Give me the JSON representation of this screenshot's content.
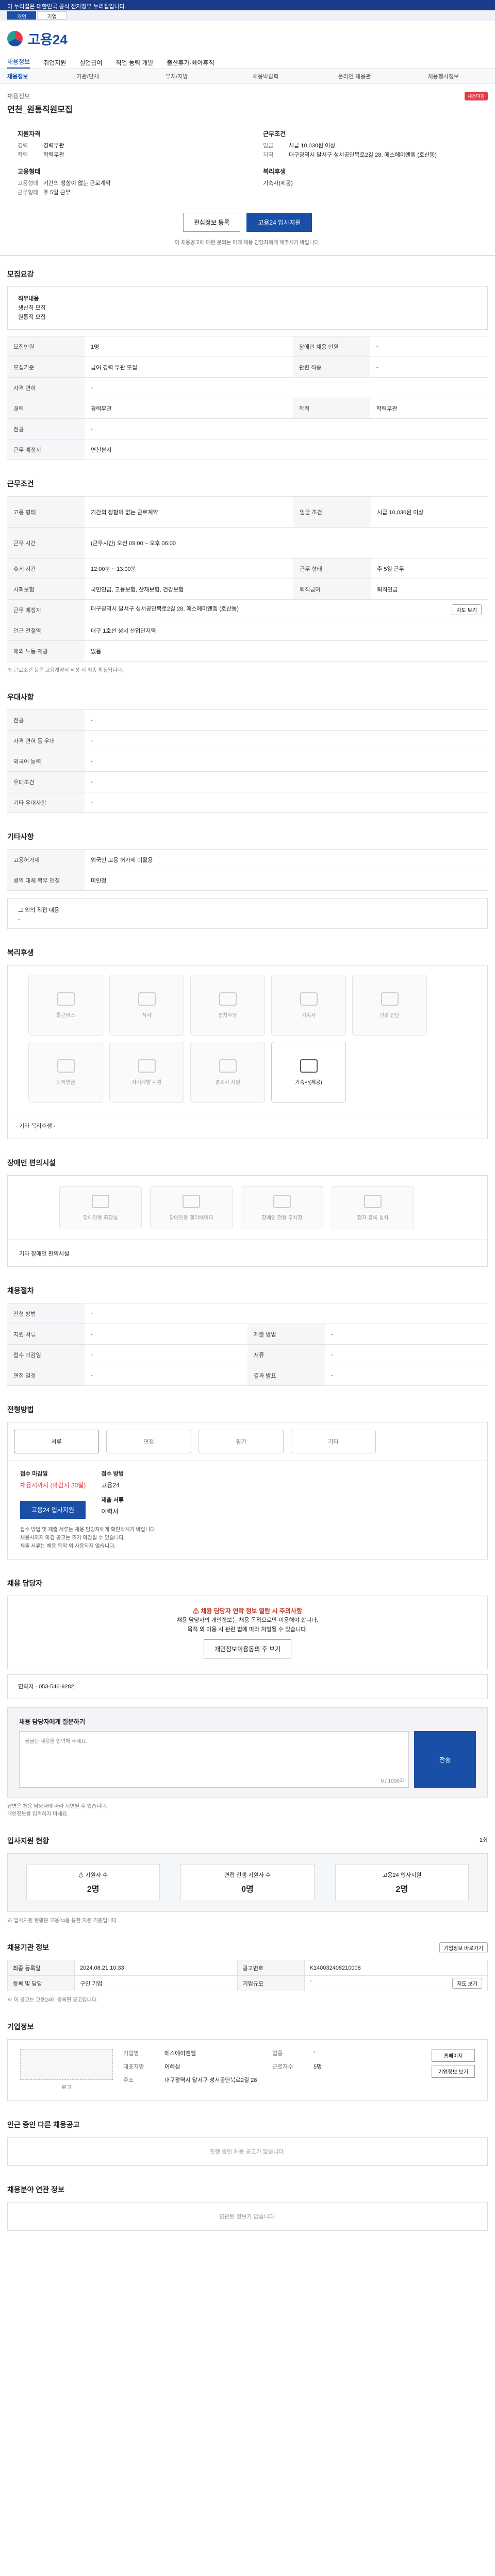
{
  "topbar": {
    "text": "이 누리집은 대한민국 공식 전자정부 누리집입니다."
  },
  "ribbon": {
    "tabs": [
      "개인",
      "기업"
    ]
  },
  "brand": {
    "name": "고용24"
  },
  "mainnav": [
    "채용정보",
    "취업지원",
    "실업급여",
    "직업 능력 개발",
    "출산휴가·육아휴직"
  ],
  "subnav": [
    "채용정보",
    "기관/단체",
    "부처/지방",
    "채용박람회",
    "온라인 채용관",
    "채용행사정보"
  ],
  "hero": {
    "company": "채용정보",
    "badge": "채용마감",
    "title": "연천_원통직원모집",
    "qual_heading": "지원자격",
    "qual": [
      {
        "k": "경력",
        "v": "경력무관"
      },
      {
        "k": "학력",
        "v": "학력무관"
      }
    ],
    "cond_heading": "근무조건",
    "cond": [
      {
        "k": "임금",
        "v": "시급 10,030원 이상"
      },
      {
        "k": "지역",
        "v": "대구광역시 달서구 성서공단북로2길 28, 에스에이엔엠 (호산동)"
      }
    ],
    "emp_heading": "고용형태",
    "emp": [
      {
        "k": "고용형태",
        "v": "기간의 정함이 없는 근로계약"
      },
      {
        "k": "근무형태",
        "v": "주 5일 근무"
      }
    ],
    "welfare_heading": "복리후생",
    "welfare_value": "기숙사(제공)",
    "btn_interest": "관심정보 등록",
    "btn_apply": "고용24 입사지원",
    "note": "이 채용공고에 대한 문의는 아래 채용 담당자에게 해주시기 바랍니다."
  },
  "recruit": {
    "title": "모집요강",
    "desc_label": "직무내용",
    "desc_lines": [
      "생산직 모집",
      "원통직 모집"
    ],
    "rows": [
      [
        "모집인원",
        "1명",
        "장애인 채용 인원",
        "-"
      ],
      [
        "모집기준",
        "급여 경력 무관 모집",
        "관련 직종",
        "-"
      ],
      [
        "자격 면허",
        "-",
        "",
        ""
      ],
      [
        "경력",
        "경력무관",
        "학력",
        "학력무관"
      ],
      [
        "전공",
        "-",
        "",
        ""
      ],
      [
        "근무 예정지",
        "연천본지",
        "",
        ""
      ]
    ]
  },
  "workcond": {
    "title": "근무조건",
    "rows": [
      [
        "고용 형태",
        "기간의 정함이 없는 근로계약",
        "임금 조건",
        "시급 10,030원 이상"
      ],
      [
        "근무 시간",
        "(근무시간) 오전 09:00 ~ 오후 06:00",
        "",
        ""
      ],
      [
        "휴게 시간",
        "12:00분 ~ 13:00분",
        "근무 형태",
        "주 5일 근무"
      ],
      [
        "사회보험",
        "국민연금, 고용보험, 산재보험, 건강보험",
        "퇴직급여",
        "퇴직연금"
      ],
      [
        "근무 예정지",
        "대구광역시 달서구 성서공단북로2길 28, 에스에이엔엠 (호산동)",
        "",
        ""
      ],
      [
        "인근 전철역",
        "대구 1호선 성서 산업단지역",
        "",
        ""
      ],
      [
        "해외 노동 제공",
        "없음",
        "",
        ""
      ]
    ],
    "map_btn": "지도 보기",
    "note": "※ 근로조건 등은 고용계약서 작성 시 최종 확정됩니다."
  },
  "pref": {
    "title": "우대사항",
    "rows": [
      [
        "전공",
        "-"
      ],
      [
        "자격 면허 등 우대",
        "-"
      ],
      [
        "외국어 능력",
        "-"
      ],
      [
        "우대조건",
        "-"
      ],
      [
        "기타 우대사항",
        "-"
      ]
    ]
  },
  "etc": {
    "title": "기타사항",
    "rows": [
      [
        "고용허가제",
        "외국인 고용 허가제 미활용"
      ],
      [
        "병역 대체 복무 인정",
        "미인정"
      ]
    ],
    "contact_label": "그 외의 직접 내용",
    "contact_value": "-"
  },
  "welfare": {
    "title": "복리후생",
    "items": [
      "통근버스",
      "식사",
      "연차수당",
      "기숙사",
      "건강 진단",
      "퇴직연금",
      "자기계발 지원",
      "경조사 지원",
      "기숙사(제공)"
    ],
    "etc_label": "기타 복리후생",
    "etc_value": "-"
  },
  "amenities": {
    "title": "장애인 편의시설",
    "items": [
      "장애인용 화장실",
      "장애인용 엘리베이터",
      "장애인 전용 주차장",
      "점자 블록 설치"
    ],
    "etc_label": "기타 장애인 편의시설"
  },
  "process": {
    "title": "채용절차",
    "rows": [
      [
        "전형 방법",
        "-",
        "",
        ""
      ],
      [
        "지원 서류",
        "-",
        "제출 방법",
        "-"
      ],
      [
        "접수 마감일",
        "-",
        "서류",
        "-"
      ],
      [
        "면접 일정",
        "-",
        "결과 발표",
        "-"
      ]
    ]
  },
  "apply": {
    "title": "전형방법",
    "steps": [
      "서류",
      "면접",
      "필기",
      "기타"
    ],
    "deadline_label": "접수 마감일",
    "deadline": "채용시까지 (마감시 30일)",
    "method_label": "접수 방법",
    "method": "고용24",
    "doc_label": "제출 서류",
    "doc": "이력서",
    "btn": "고용24 입사지원",
    "bullets": [
      "접수 방법 및 제출 서류는 채용 담당자에게 확인하시기 바랍니다.",
      "채용시까지 마감 공고는 조기 마감될 수 있습니다.",
      "제출 서류는 채용 목적 외 사용되지 않습니다."
    ]
  },
  "manager": {
    "title": "채용 담당자",
    "alert": "채용 담당자 연락 정보 열람 시 주의사항",
    "lines": [
      "채용 담당자의 개인정보는 채용 목적으로만 이용해야 합니다.",
      "목적 외 이용 시 관련 법에 따라 처벌될 수 있습니다."
    ],
    "btn": "개인정보이용동의 후 보기",
    "phone_label": "연락처",
    "phone": "053-546-9282",
    "q_title": "채용 담당자에게 질문하기",
    "q_hint": "궁금한 내용을 입력해 주세요.",
    "q_count": "0 / 1000자",
    "q_send": "전송",
    "q_bullets": [
      "답변은 채용 담당자에 따라 지연될 수 있습니다.",
      "개인정보를 입력하지 마세요."
    ]
  },
  "stats": {
    "title": "입사지원 현황",
    "count": "1회",
    "items": [
      {
        "k": "총 지원자 수",
        "v": "2명"
      },
      {
        "k": "면접 진행 지원자 수",
        "v": "0명"
      },
      {
        "k": "고용24 입사지원",
        "v": "2명"
      }
    ],
    "note": "※ 입사지원 현황은 고용24를 통한 지원 기준입니다."
  },
  "info": {
    "title": "채용기관 정보",
    "link": "기업정보 바로가기",
    "rows": [
      [
        "최종 등록일",
        "2024.08.21 10:33",
        "공고번호",
        "K140032408210008"
      ],
      [
        "등록 및 담당",
        "구인 기업",
        "기업규모",
        "-"
      ]
    ],
    "map_btn": "지도 보기",
    "note": "※ 이 공고는 고용24에 등록된 공고입니다."
  },
  "company": {
    "title": "기업정보",
    "logo_caption": "로고",
    "rows": [
      [
        "기업명",
        "에스에이엔엠",
        "업종",
        "-"
      ],
      [
        "대표자명",
        "이혜성",
        "근로자수",
        "5명"
      ],
      [
        "주소",
        "대구광역시 달서구 성서공단북로2길 28",
        "",
        ""
      ]
    ],
    "btn_home": "홈페이지",
    "btn_info": "기업정보 보기"
  },
  "more": {
    "title": "인근 중인 다른 채용공고",
    "empty": "진행 중인 채용 공고가 없습니다."
  },
  "similar": {
    "title": "채용분야 연관 정보",
    "empty": "연관된 정보가 없습니다."
  }
}
